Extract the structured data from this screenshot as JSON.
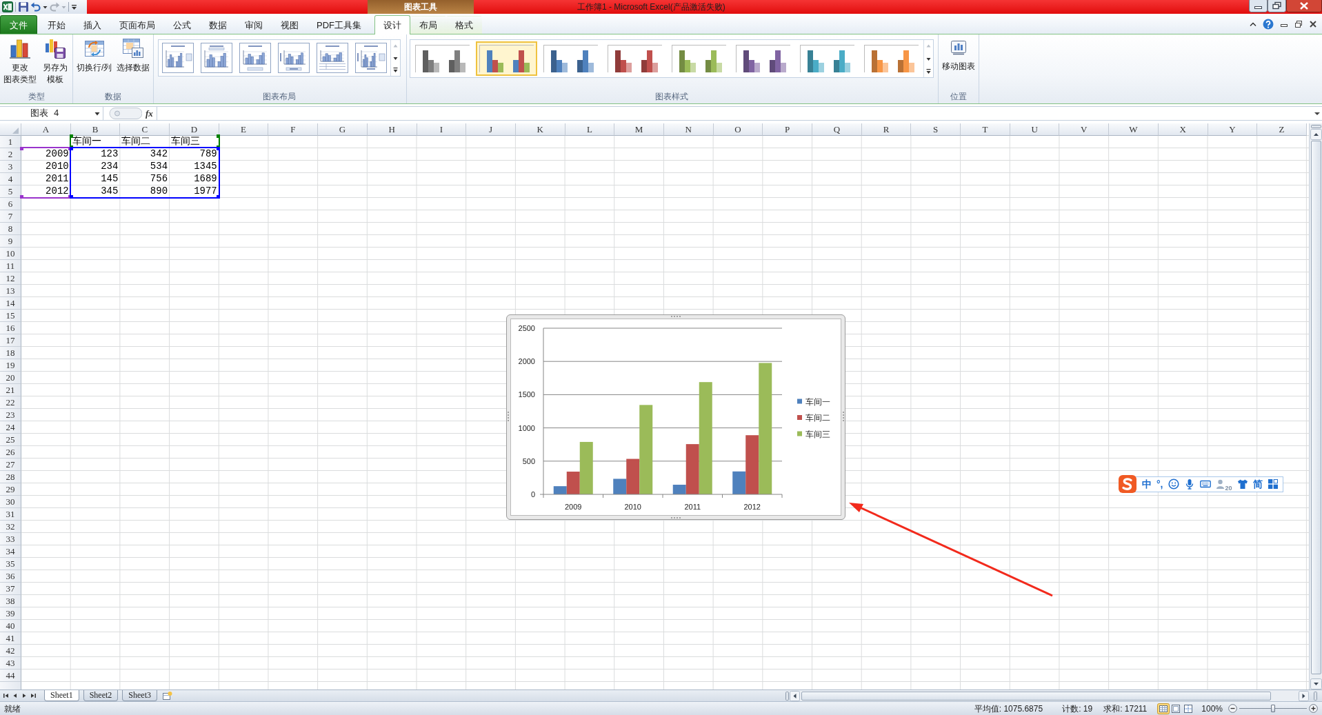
{
  "title_bar": {
    "quick_access": [
      {
        "kind": "save",
        "disabled": false
      },
      {
        "kind": "undo",
        "disabled": false
      },
      {
        "kind": "redo",
        "disabled": true
      }
    ],
    "context_group": "图表工具",
    "title": "工作簿1 - Microsoft Excel(产品激活失败)"
  },
  "ribbon_tabs": [
    {
      "label": "文件",
      "kind": "file",
      "selected": false
    },
    {
      "label": "开始",
      "kind": "tab",
      "selected": false
    },
    {
      "label": "插入",
      "kind": "tab",
      "selected": false
    },
    {
      "label": "页面布局",
      "kind": "tab",
      "selected": false
    },
    {
      "label": "公式",
      "kind": "tab",
      "selected": false
    },
    {
      "label": "数据",
      "kind": "tab",
      "selected": false
    },
    {
      "label": "审阅",
      "kind": "tab",
      "selected": false
    },
    {
      "label": "视图",
      "kind": "tab",
      "selected": false
    },
    {
      "label": "PDF工具集",
      "kind": "tab",
      "selected": false
    },
    {
      "label": "设计",
      "kind": "context",
      "selected": true
    },
    {
      "label": "布局",
      "kind": "context",
      "selected": false
    },
    {
      "label": "格式",
      "kind": "context",
      "selected": false
    }
  ],
  "ribbon_groups": [
    {
      "label": "类型",
      "kind": "buttons",
      "buttons": [
        {
          "kind": "change_chart_type",
          "lines": [
            "更改",
            "图表类型"
          ]
        },
        {
          "kind": "save_as_template",
          "lines": [
            "另存为",
            "模板"
          ]
        }
      ]
    },
    {
      "label": "数据",
      "kind": "buttons",
      "buttons": [
        {
          "kind": "switch_row_column",
          "lines": [
            "切换行/列"
          ]
        },
        {
          "kind": "select_data",
          "lines": [
            "选择数据"
          ]
        }
      ]
    },
    {
      "label": "图表布局",
      "kind": "layouts"
    },
    {
      "label": "图表样式",
      "kind": "styles",
      "styles": [
        {
          "kind": "mono",
          "color": "#7f7f7f",
          "selected": false
        },
        {
          "kind": "multi",
          "selected": true
        },
        {
          "kind": "mono",
          "color": "#4f81bd",
          "selected": false
        },
        {
          "kind": "mono",
          "color": "#c0504d",
          "selected": false
        },
        {
          "kind": "mono",
          "color": "#9bbb59",
          "selected": false
        },
        {
          "kind": "mono",
          "color": "#8064a2",
          "selected": false
        },
        {
          "kind": "mono",
          "color": "#4bacc6",
          "selected": false
        },
        {
          "kind": "mono",
          "color": "#f79646",
          "selected": false
        }
      ]
    },
    {
      "label": "位置",
      "kind": "buttons",
      "buttons": [
        {
          "kind": "move_chart",
          "lines": [
            "移动图表"
          ]
        }
      ]
    }
  ],
  "formula_bar": {
    "name_box": "图表 4",
    "function_button": "fx"
  },
  "sheet": {
    "columns": [
      "A",
      "B",
      "C",
      "D",
      "E",
      "F",
      "G",
      "H",
      "I",
      "J",
      "K",
      "L",
      "M",
      "N",
      "O",
      "P",
      "Q",
      "R",
      "S",
      "T",
      "U",
      "V",
      "W",
      "X",
      "Y",
      "Z"
    ],
    "rows": [
      "1",
      "2",
      "3",
      "4",
      "5",
      "6",
      "7",
      "8",
      "9",
      "10",
      "11",
      "12",
      "13",
      "14",
      "15",
      "16",
      "17",
      "18",
      "19",
      "20",
      "21",
      "22",
      "23",
      "24",
      "25",
      "26",
      "27",
      "28",
      "29",
      "30",
      "31",
      "32",
      "33",
      "34",
      "35",
      "36",
      "37",
      "38",
      "39",
      "40",
      "41",
      "42",
      "43",
      "44"
    ],
    "cells": [
      {
        "kind": "text",
        "B": "车间一",
        "C": "车间二",
        "D": "车间三"
      },
      {
        "kind": "number",
        "A": "2009",
        "B": "123",
        "C": "342",
        "D": "789"
      },
      {
        "kind": "number",
        "A": "2010",
        "B": "234",
        "C": "534",
        "D": "1345"
      },
      {
        "kind": "number",
        "A": "2011",
        "B": "145",
        "C": "756",
        "D": "1689"
      },
      {
        "kind": "number",
        "A": "2012",
        "B": "345",
        "C": "890",
        "D": "1977"
      }
    ],
    "chart_ranges": [
      {
        "kind": "categories",
        "color": "#9933cc"
      },
      {
        "kind": "series_names",
        "color": "#008000"
      },
      {
        "kind": "values",
        "color": "#0000ff"
      }
    ],
    "chart": {
      "chart_data": {
        "type": "bar",
        "categories": [
          "2009",
          "2010",
          "2011",
          "2012"
        ],
        "series": [
          {
            "name": "车间一",
            "color": "#4f81bd",
            "values": [
              123,
              234,
              145,
              345
            ]
          },
          {
            "name": "车间二",
            "color": "#c0504d",
            "values": [
              342,
              534,
              756,
              890
            ]
          },
          {
            "name": "车间三",
            "color": "#9bbb59",
            "values": [
              789,
              1345,
              1689,
              1977
            ]
          }
        ],
        "ylim": [
          0,
          2500
        ],
        "yticks": [
          0,
          500,
          1000,
          1500,
          2000,
          2500
        ],
        "grid": true,
        "legend": "right"
      }
    }
  },
  "ime_toolbar": {
    "items": [
      {
        "kind": "logo"
      },
      {
        "kind": "language",
        "label": "中"
      },
      {
        "kind": "punctuation",
        "label": "°,"
      },
      {
        "kind": "emoji"
      },
      {
        "kind": "voice"
      },
      {
        "kind": "keyboard"
      },
      {
        "kind": "account",
        "badge": "20"
      },
      {
        "kind": "skin"
      },
      {
        "kind": "script",
        "label": "简"
      },
      {
        "kind": "toolbox"
      }
    ]
  },
  "sheet_tabs": [
    {
      "label": "Sheet1",
      "selected": true
    },
    {
      "label": "Sheet2",
      "selected": false
    },
    {
      "label": "Sheet3",
      "selected": false
    }
  ],
  "status_bar": {
    "mode": "就绪",
    "average": "平均值: 1075.6875",
    "count": "计数: 19",
    "sum": "求和: 17211",
    "views": [
      {
        "kind": "normal",
        "selected": true
      },
      {
        "kind": "page_layout",
        "selected": false
      },
      {
        "kind": "page_break",
        "selected": false
      }
    ],
    "zoom": "100%",
    "zoom_slider": {
      "level": 0.5
    }
  }
}
